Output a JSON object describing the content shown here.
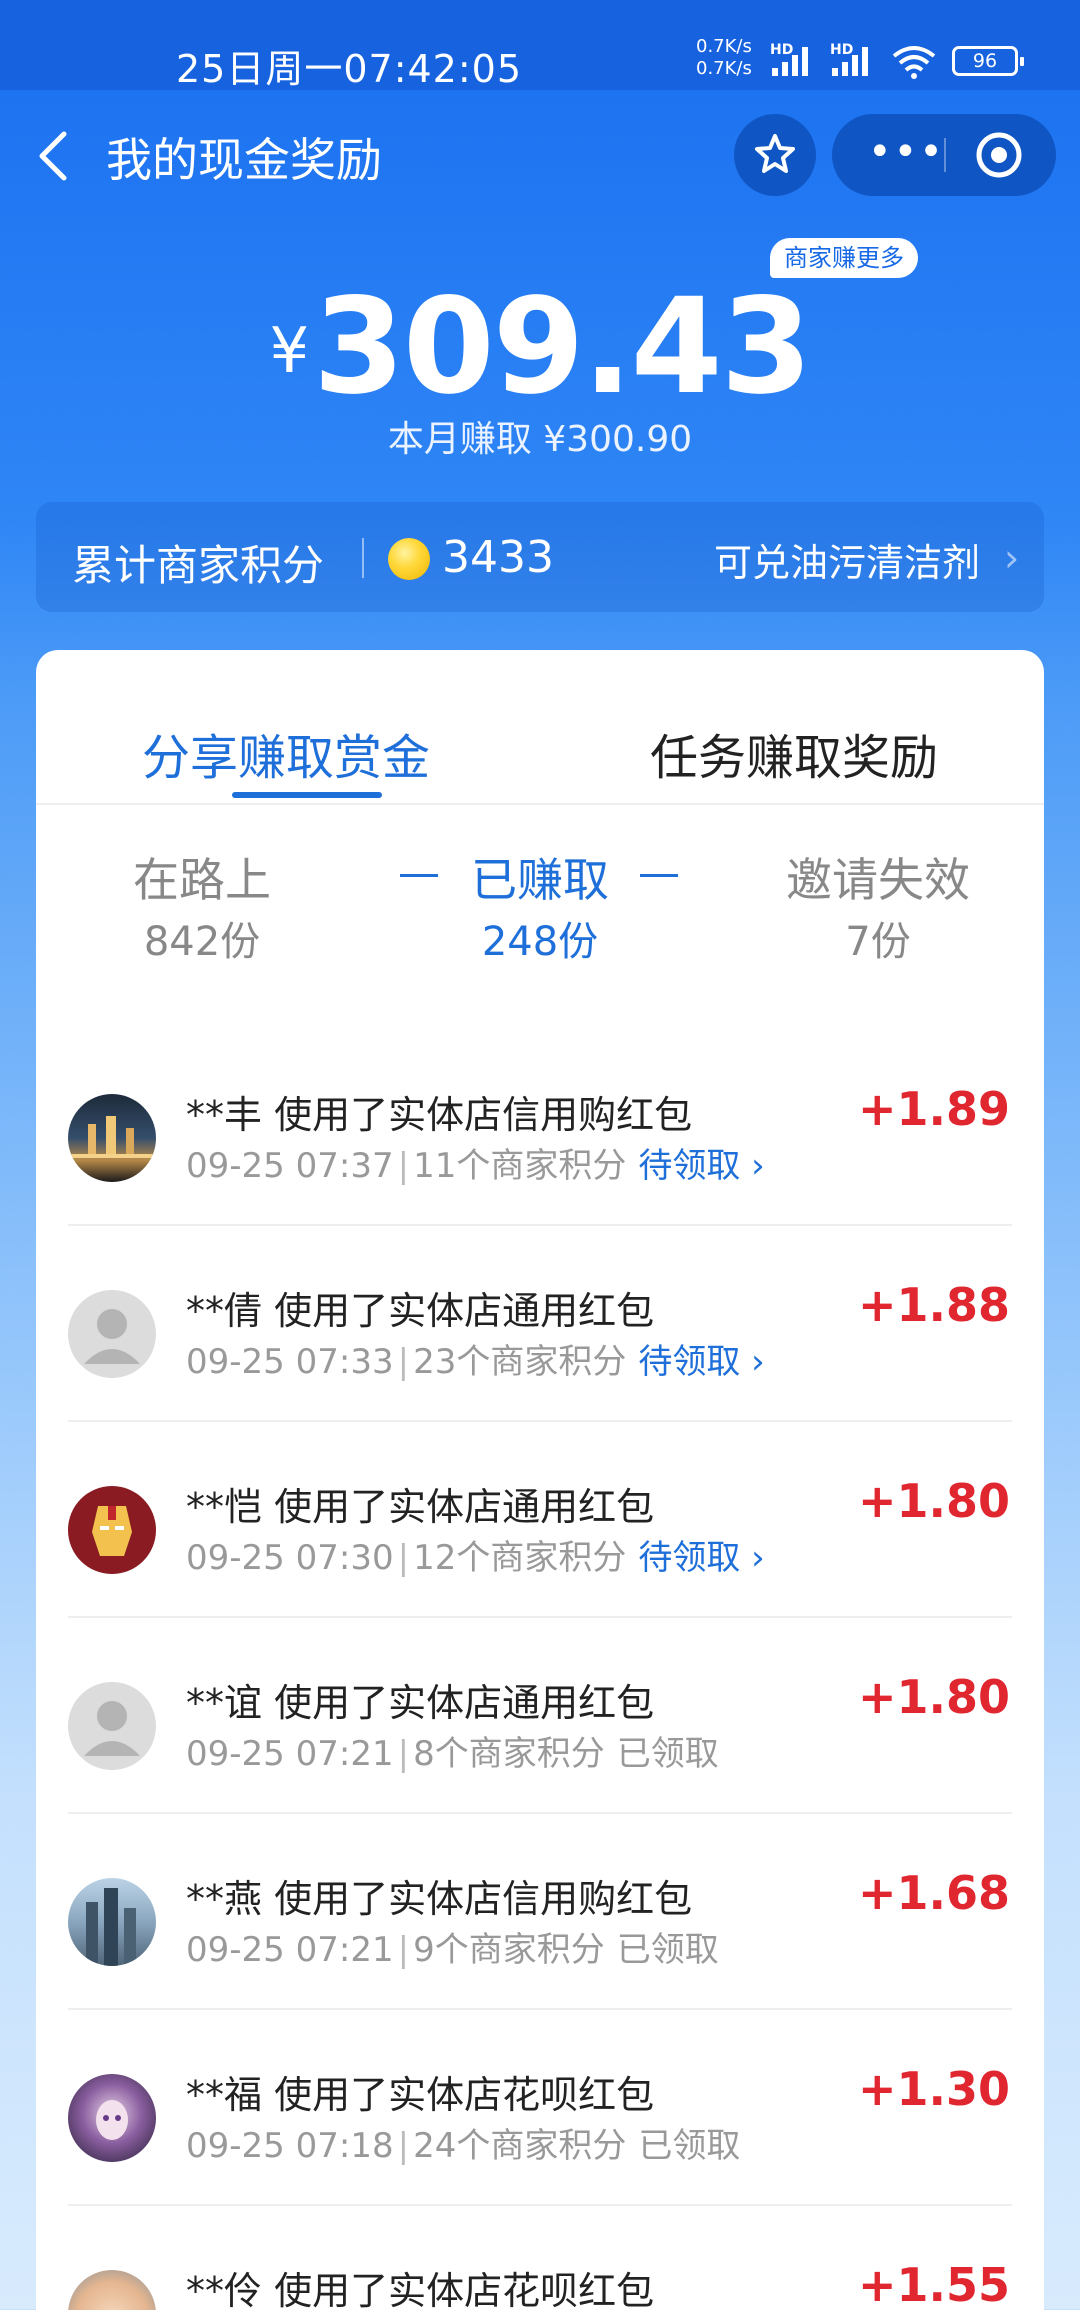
{
  "status_bar": {
    "datetime": "25日周一07:42:05",
    "net_speed_up": "0.7K/s",
    "net_speed_down": "0.7K/s",
    "hd_label": "HD",
    "battery": "96"
  },
  "nav": {
    "title": "我的现金奖励",
    "more_glyph": "•••"
  },
  "summary": {
    "badge": "商家赚更多",
    "currency_symbol": "¥",
    "total_amount": "309.43",
    "month_earned": "本月赚取 ¥300.90"
  },
  "points": {
    "label": "累计商家积分",
    "count": "3433",
    "exchange_text": "可兑油污清洁剂",
    "chevron": "›"
  },
  "tabs": [
    {
      "label": "分享赚取赏金",
      "active": true
    },
    {
      "label": "任务赚取奖励",
      "active": false
    }
  ],
  "stats": {
    "on_the_way": {
      "label": "在路上",
      "value": "842份"
    },
    "earned": {
      "label": "已赚取",
      "value": "248份"
    },
    "invalid": {
      "label": "邀请失效",
      "value": "7份"
    }
  },
  "records": [
    {
      "title": "**丰 使用了实体店信用购红包",
      "time": "09-25 07:37",
      "points": "11个商家积分",
      "status": "待领取",
      "status_chevron": "›",
      "amount": "+1.89",
      "avatar": "city-night-avatar"
    },
    {
      "title": "**倩 使用了实体店通用红包",
      "time": "09-25 07:33",
      "points": "23个商家积分",
      "status": "待领取",
      "status_chevron": "›",
      "amount": "+1.88",
      "avatar": "default-user-avatar"
    },
    {
      "title": "**恺 使用了实体店通用红包",
      "time": "09-25 07:30",
      "points": "12个商家积分",
      "status": "待领取",
      "status_chevron": "›",
      "amount": "+1.80",
      "avatar": "ironman-avatar"
    },
    {
      "title": "**谊 使用了实体店通用红包",
      "time": "09-25 07:21",
      "points": "8个商家积分",
      "status": "已领取",
      "status_chevron": "",
      "amount": "+1.80",
      "avatar": "default-user-avatar"
    },
    {
      "title": "**燕 使用了实体店信用购红包",
      "time": "09-25 07:21",
      "points": "9个商家积分",
      "status": "已领取",
      "status_chevron": "",
      "amount": "+1.68",
      "avatar": "skyscraper-avatar"
    },
    {
      "title": "**福 使用了实体店花呗红包",
      "time": "09-25 07:18",
      "points": "24个商家积分",
      "status": "已领取",
      "status_chevron": "",
      "amount": "+1.30",
      "avatar": "anime-girl-avatar"
    },
    {
      "title": "**伶 使用了实体店花呗红包",
      "time": "",
      "points": "",
      "status": "",
      "status_chevron": "",
      "amount": "+1.55",
      "avatar": "baby-photo-avatar"
    }
  ],
  "colors": {
    "brand_blue": "#1e6fd9",
    "amount_red": "#e0262f",
    "header_blue": "#1762df"
  }
}
